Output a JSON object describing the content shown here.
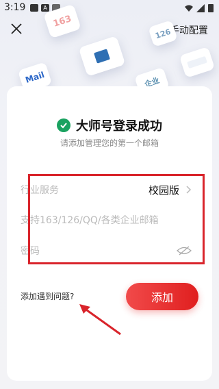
{
  "status": {
    "time": "3:19"
  },
  "header": {
    "manual_config": "手动配置"
  },
  "tiles": {
    "t163": "163",
    "t126": "126",
    "mail": "Mail",
    "enterprise": "企业",
    "box": ""
  },
  "card": {
    "title": "大师号登录成功",
    "subtitle": "请添加管理您的第一个邮箱",
    "industry_label": "行业服务",
    "industry_value": "校园版",
    "email_placeholder": "支持163/126/QQ/各类企业邮箱",
    "password_placeholder": "密码"
  },
  "help_text": "添加遇到问题?",
  "add_button": "添加",
  "colors": {
    "accent": "#e8292c",
    "success": "#1aa260",
    "highlight": "#d9242b"
  }
}
